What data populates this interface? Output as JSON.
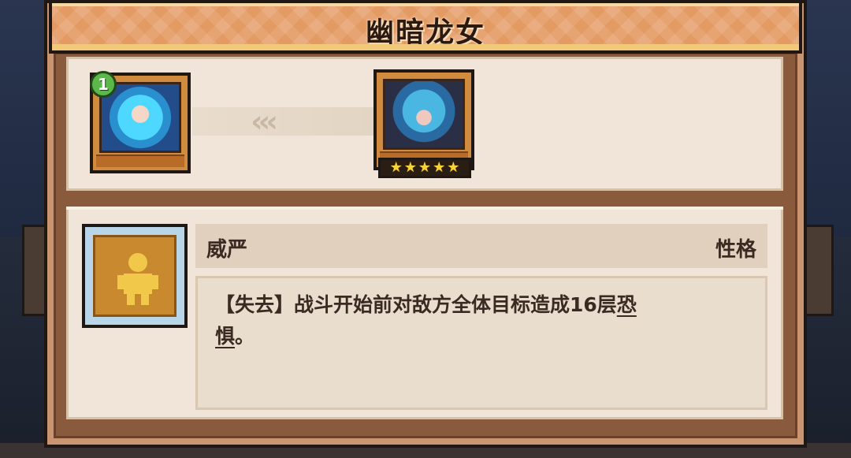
{
  "window": {
    "title": "幽暗龙女"
  },
  "hero_from": {
    "level": "1",
    "portrait_icon": "hero-portrait-blue-hair-girl"
  },
  "hero_to": {
    "portrait_icon": "hero-portrait-dark-dragon-girl",
    "stars": 5
  },
  "transition": {
    "arrow_glyphs": "‹‹‹"
  },
  "trait": {
    "name": "威严",
    "type": "性格",
    "icon": "trait-silhouette-icon",
    "description_part1": "【失去】战斗开始前对敌方全体目标造成16层",
    "description_keyword_a": "恐",
    "description_keyword_b": "惧",
    "description_end": "。"
  },
  "colors": {
    "title_bar": "#e49a63",
    "panel": "#c99470",
    "card": "#f0e5d8",
    "star": "#f7d338",
    "level_badge": "#5cb84a"
  }
}
